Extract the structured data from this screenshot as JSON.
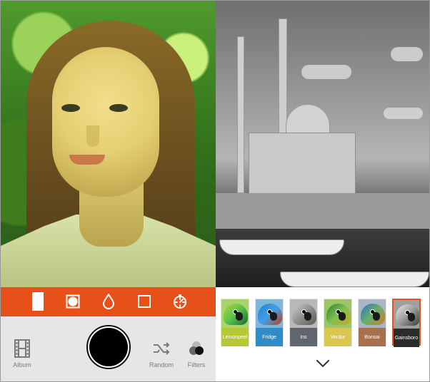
{
  "left_panel": {
    "toolbar_icons": [
      "aspect-ratio-icon",
      "circle-frame-icon",
      "drop-icon",
      "square-frame-icon",
      "timer-icon"
    ],
    "nav": {
      "album_label": "Album",
      "random_label": "Random",
      "filters_label": "Filters"
    }
  },
  "right_panel": {
    "filters": [
      {
        "name": "Lemonpeel",
        "color": "#b7c835"
      },
      {
        "name": "Fridge",
        "color": "#2f8cc7"
      },
      {
        "name": "Ins",
        "color": "#5f6670"
      },
      {
        "name": "Verdur",
        "color": "#d8c84f"
      },
      {
        "name": "Bonsai",
        "color": "#a6724d"
      },
      {
        "name": "Gainsboro",
        "color": "#2b2b2b",
        "selected": true
      }
    ]
  },
  "colors": {
    "accent": "#e8501a",
    "bottom_bg": "#e6e6e6",
    "nav_text": "#7b7b7b"
  }
}
